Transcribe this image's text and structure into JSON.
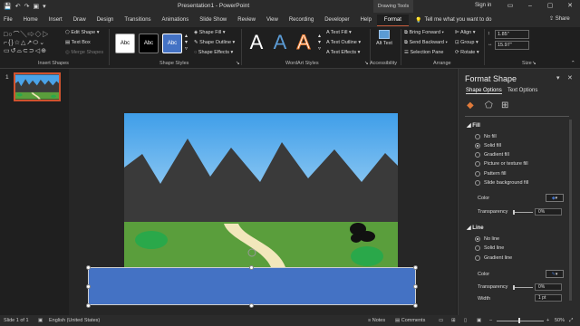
{
  "window": {
    "title": "Presentation1 - PowerPoint",
    "contextual_tab_group": "Drawing Tools",
    "sign_in": "Sign in",
    "tell_me_placeholder": "Tell me what you want to do",
    "share": "Share"
  },
  "tabs": [
    "File",
    "Home",
    "Insert",
    "Draw",
    "Design",
    "Transitions",
    "Animations",
    "Slide Show",
    "Review",
    "View",
    "Recording",
    "Developer",
    "Help"
  ],
  "active_tab": "Format",
  "ribbon": {
    "insert_shapes": {
      "edit_shape": "Edit Shape",
      "text_box": "Text Box",
      "merge_shapes": "Merge Shapes",
      "label": "Insert Shapes"
    },
    "shape_styles": {
      "styles": [
        "Abc",
        "Abc",
        "Abc"
      ],
      "fill": "Shape Fill",
      "outline": "Shape Outline",
      "effects": "Shape Effects",
      "label": "Shape Styles"
    },
    "wordart_styles": {
      "letters": [
        "A",
        "A",
        "A"
      ],
      "text_fill": "Text Fill",
      "text_outline": "Text Outline",
      "text_effects": "Text Effects",
      "label": "WordArt Styles"
    },
    "accessibility": {
      "alt_text": "Alt Text",
      "label": "Accessibility"
    },
    "arrange": {
      "bring_forward": "Bring Forward",
      "send_backward": "Send Backward",
      "selection_pane": "Selection Pane",
      "align": "Align",
      "group": "Group",
      "rotate": "Rotate",
      "label": "Arrange"
    },
    "size": {
      "height": "1.85\"",
      "width": "15.97\"",
      "label": "Size"
    }
  },
  "thumbnails": [
    {
      "number": "1"
    }
  ],
  "format_pane": {
    "title": "Format Shape",
    "subtabs": [
      "Shape Options",
      "Text Options"
    ],
    "fill": {
      "heading": "Fill",
      "options": [
        "No fill",
        "Solid fill",
        "Gradient fill",
        "Picture or texture fill",
        "Pattern fill",
        "Slide background fill"
      ],
      "selected": "Solid fill",
      "color_label": "Color",
      "transparency_label": "Transparency",
      "transparency_value": "0%"
    },
    "line": {
      "heading": "Line",
      "options": [
        "No line",
        "Solid line",
        "Gradient line"
      ],
      "selected": "No line",
      "color_label": "Color",
      "transparency_label": "Transparency",
      "transparency_value": "0%",
      "width_label": "Width",
      "width_value": "1 pt"
    }
  },
  "status": {
    "slide": "Slide 1 of 1",
    "language": "English (United States)",
    "notes": "Notes",
    "comments": "Comments",
    "zoom": "50%"
  },
  "colors": {
    "accent": "#c55a3b",
    "shape_fill": "#4472c4",
    "sky_top": "#4aa3e8",
    "mountains": "#3a3a3a",
    "grass": "#5a9e3c",
    "bush": "#2aa84a"
  }
}
